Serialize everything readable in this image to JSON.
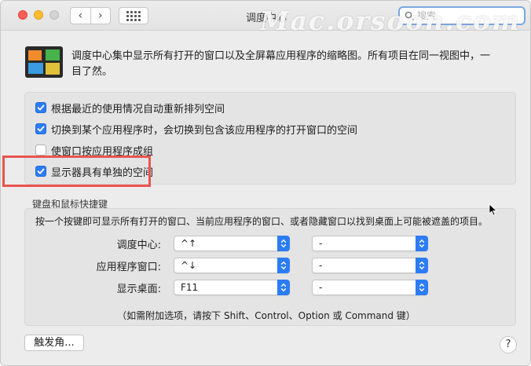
{
  "window": {
    "title": "调度中心",
    "nav_back": "‹",
    "nav_forward": "›"
  },
  "search": {
    "placeholder": "搜索"
  },
  "watermark": "Mac.orsoon.com",
  "description": "调度中心集中显示所有打开的窗口以及全屏幕应用程序的缩略图。所有项目在同一视图中，一目了然。",
  "options": [
    {
      "label": "根据最近的使用情况自动重新排列空间",
      "checked": true
    },
    {
      "label": "切换到某个应用程序时，会切换到包含该应用程序的打开窗口的空间",
      "checked": true
    },
    {
      "label": "使窗口按应用程序成组",
      "checked": false
    },
    {
      "label": "显示器具有单独的空间",
      "checked": true
    }
  ],
  "shortcuts": {
    "title": "键盘和鼠标快捷键",
    "description": "按一个按键即可显示所有打开的窗口、当前应用程序的窗口、或者隐藏窗口以找到桌面上可能被遮盖的项目。",
    "rows": [
      {
        "label": "调度中心:",
        "key": "^↑",
        "mouse": "-"
      },
      {
        "label": "应用程序窗口:",
        "key": "^↓",
        "mouse": "-"
      },
      {
        "label": "显示桌面:",
        "key": "F11",
        "mouse": "-"
      }
    ],
    "note": "（如需附加选项，请按下 Shift、Control、Option 或 Command 键）"
  },
  "buttons": {
    "hot_corners": "触发角...",
    "help": "?"
  },
  "colors": {
    "accent": "#2c7cf6",
    "highlight": "#e8554e"
  }
}
